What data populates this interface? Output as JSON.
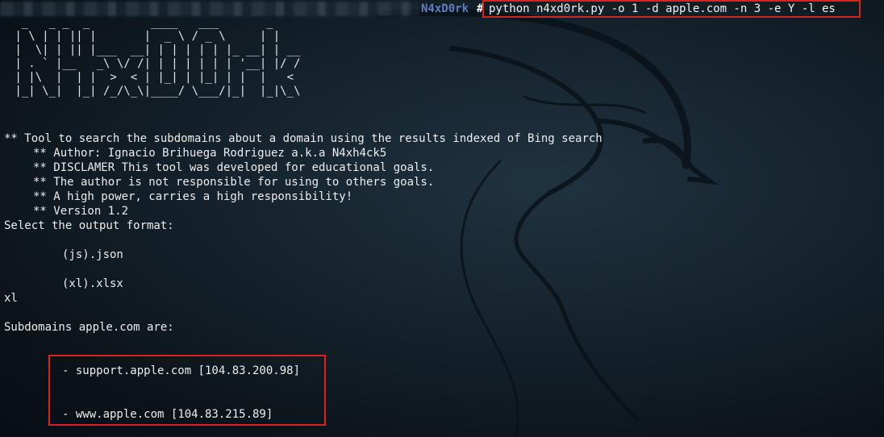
{
  "prompt": {
    "host": "N4xD0rk",
    "symbol": "#",
    "command": "python n4xd0rk.py -o 1 -d apple.com -n 3 -e Y -l es"
  },
  "banner": {
    "art": "  _   _ _  _         ____   ___       _    \n | \\ | | || |       |  _ \\ / _ \\     | |   \n |  \\| | || |___  __| | | | | | |_ __| | __\n | . ` |__   _\\ \\/ /| | | | | | | '__| |/ /\n | |\\  |  | |  >  < | |_| | |_| | |  |   < \n |_| \\_|  |_| /_/\\_\\|____/ \\___/|_|  |_|\\_\\"
  },
  "info": {
    "tagline": "** Tool to search the subdomains about a domain using the results indexed of Bing search",
    "author": "** Author: Ignacio Brihuega Rodriguez a.k.a N4xh4ck5",
    "disclaimer": "** DISCLAMER This tool was developed for educational goals.",
    "responsibility": "** The author is not responsible for using to others goals.",
    "power": "** A high power, carries a high responsibility!",
    "version": "** Version 1.2"
  },
  "format_menu": {
    "prompt": "Select the output format:",
    "options": [
      "(js).json",
      "(xl).xlsx"
    ],
    "user_input": "xl"
  },
  "results": {
    "heading": "Subdomains apple.com are:",
    "items": [
      "- support.apple.com [104.83.200.98]",
      "- www.apple.com [104.83.215.89]"
    ]
  },
  "colors": {
    "highlight_box": "#e02020",
    "prompt_host": "#5f7dbf",
    "text": "#ededed"
  }
}
